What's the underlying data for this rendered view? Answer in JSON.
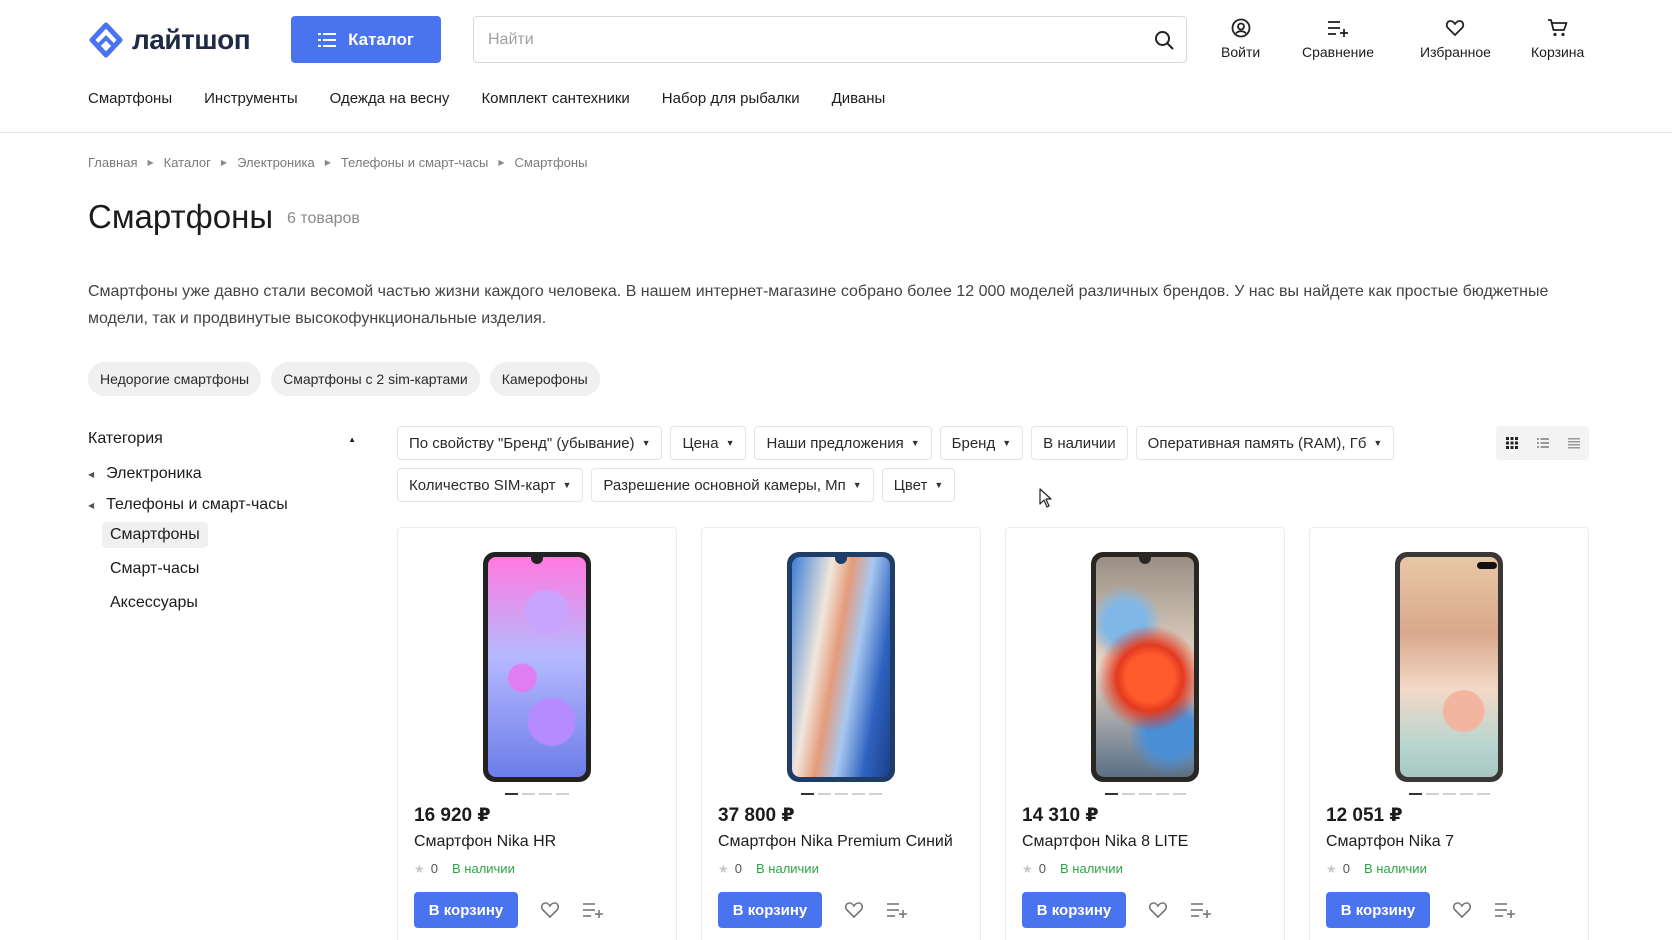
{
  "header": {
    "logo_text": "лайтшоп",
    "catalog_label": "Каталог",
    "search_placeholder": "Найти",
    "actions": {
      "login": "Войти",
      "compare": "Сравнение",
      "favorites": "Избранное",
      "cart": "Корзина"
    }
  },
  "nav": [
    "Смартфоны",
    "Инструменты",
    "Одежда на весну",
    "Комплект сантехники",
    "Набор для рыбалки",
    "Диваны"
  ],
  "breadcrumb": [
    "Главная",
    "Каталог",
    "Электроника",
    "Телефоны и смарт-часы",
    "Смартфоны"
  ],
  "page": {
    "title": "Смартфоны",
    "count": "6 товаров",
    "description": "Смартфоны уже давно стали весомой частью жизни каждого человека. В нашем интернет-магазине собрано более 12 000 моделей различных брендов. У нас вы найдете как простые бюджетные модели, так и продвинутые высокофункциональные изделия."
  },
  "chips": [
    "Недорогие смартфоны",
    "Смартфоны с 2 sim-картами",
    "Камерофоны"
  ],
  "sidebar": {
    "heading": "Категория",
    "items": [
      "Электроника",
      "Телефоны и смарт-часы"
    ],
    "subitems": [
      "Смартфоны",
      "Смарт-часы",
      "Аксессуары"
    ],
    "active_subitem": "Смартфоны"
  },
  "filters": [
    "По свойству \"Бренд\" (убывание)",
    "Цена",
    "Наши предложения",
    "Бренд",
    "В наличии",
    "Оперативная память (RAM), Гб",
    "Количество SIM-карт",
    "Разрешение основной камеры, Мп",
    "Цвет"
  ],
  "products": [
    {
      "price": "16 920 ₽",
      "name": "Смартфон Nika HR",
      "rating": "0",
      "stock": "В наличии",
      "buy": "В корзину"
    },
    {
      "price": "37 800 ₽",
      "name": "Смартфон Nika Premium Синий",
      "rating": "0",
      "stock": "В наличии",
      "buy": "В корзину"
    },
    {
      "price": "14 310 ₽",
      "name": "Смартфон Nika 8 LITE",
      "rating": "0",
      "stock": "В наличии",
      "buy": "В корзину"
    },
    {
      "price": "12 051 ₽",
      "name": "Смартфон Nika 7",
      "rating": "0",
      "stock": "В наличии",
      "buy": "В корзину"
    }
  ],
  "colors": {
    "accent": "#4a73f0",
    "in_stock": "#2fa447"
  }
}
